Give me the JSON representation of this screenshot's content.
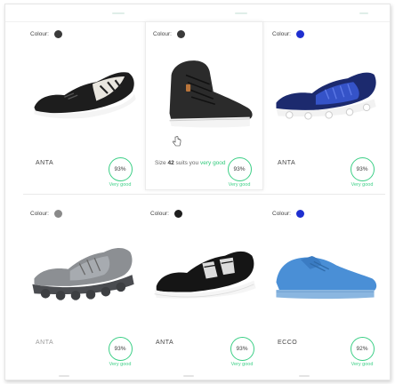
{
  "colour_label": "Colour:",
  "products": [
    {
      "colour_hex": "#3a3a3a",
      "brand": "ANTA",
      "brand_style": "normal",
      "score": "93%",
      "rating": "Very good",
      "icon": "black-white-running-shoe"
    },
    {
      "colour_hex": "#3a3a3a",
      "brand": "",
      "brand_style": "normal",
      "score": "93%",
      "rating": "Very good",
      "icon": "black-high-top-leather-sneaker",
      "size_note": {
        "prefix": "Size",
        "size": "42",
        "middle": "suits you",
        "good": "very good"
      }
    },
    {
      "colour_hex": "#1f2fd0",
      "brand": "ANTA",
      "brand_style": "normal",
      "score": "93%",
      "rating": "Very good",
      "icon": "blue-knit-running-shoe"
    },
    {
      "colour_hex": "#8a8a8a",
      "brand": "ANTA",
      "brand_style": "faded",
      "score": "93%",
      "rating": "Very good",
      "icon": "grey-chunky-running-shoe"
    },
    {
      "colour_hex": "#1e1e1e",
      "brand": "ANTA",
      "brand_style": "normal",
      "score": "93%",
      "rating": "Very good",
      "icon": "black-mesh-sneaker"
    },
    {
      "colour_hex": "#1f2fd0",
      "brand": "ECCO",
      "brand_style": "normal",
      "score": "92%",
      "rating": "Very good",
      "icon": "blue-leather-sneaker"
    }
  ],
  "colors": {
    "accent_green": "#3ccf86",
    "border": "#ececec"
  }
}
